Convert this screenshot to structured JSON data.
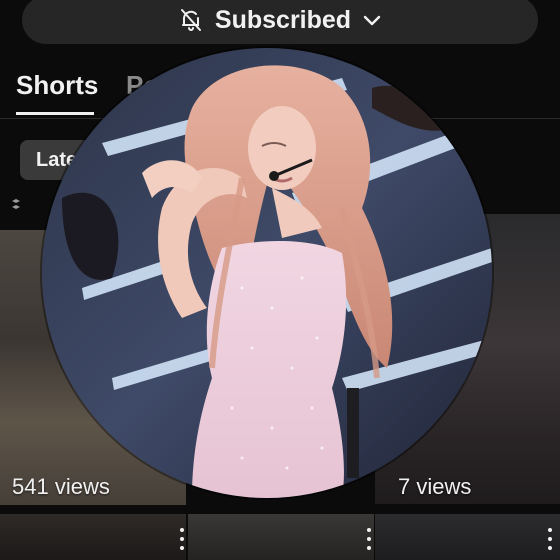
{
  "header": {
    "subscribe_label": "Subscribed",
    "bell_icon": "notifications-off-icon",
    "chevron_icon": "chevron-down-icon"
  },
  "tabs": [
    {
      "label": "Shorts",
      "active": true
    },
    {
      "label": "Po",
      "active": false
    }
  ],
  "filter_chip": {
    "label": "Late"
  },
  "shorts": [
    {
      "views": "541 views"
    },
    {
      "views": "7 views"
    }
  ],
  "colors": {
    "background": "#0b0b0b",
    "pill": "#262626",
    "chip": "#3a3a3a",
    "text": "#f1f1f1",
    "muted_text": "#8a8a8a"
  }
}
